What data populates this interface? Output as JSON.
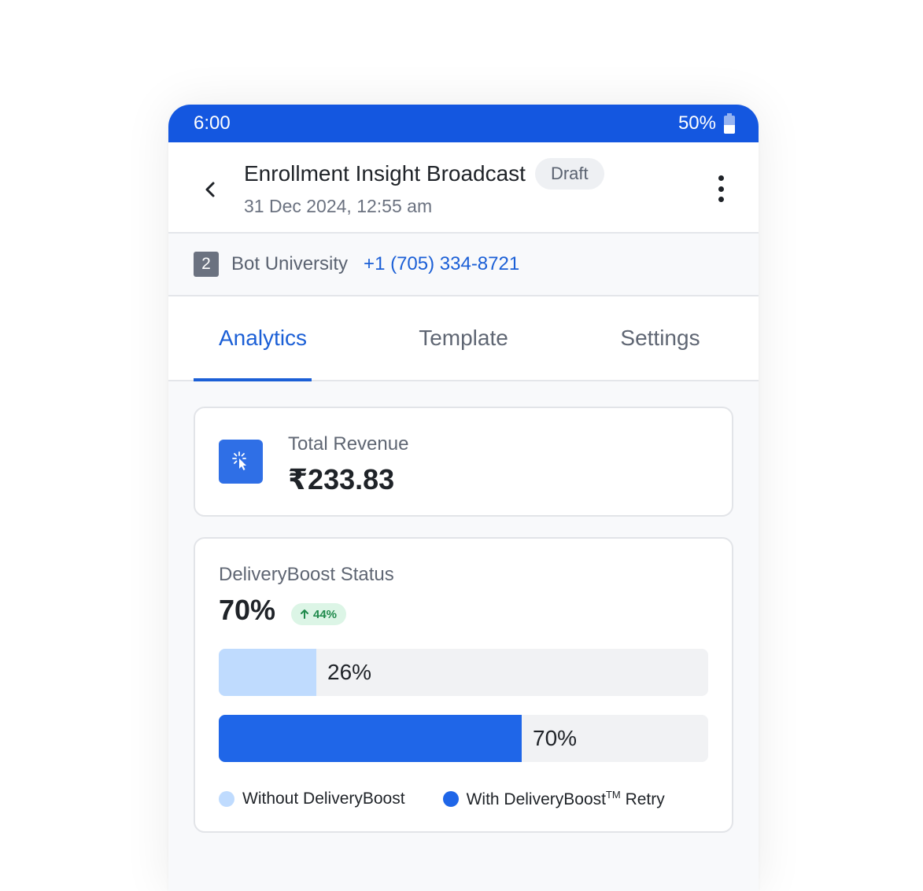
{
  "statusbar": {
    "time": "6:00",
    "battery": "50%",
    "battery_level": 0.5
  },
  "header": {
    "title": "Enrollment Insight Broadcast",
    "badge": "Draft",
    "date": "31 Dec 2024, 12:55 am"
  },
  "sender": {
    "count": "2",
    "name": "Bot University",
    "phone": "+1 (705) 334-8721"
  },
  "tabs": [
    {
      "label": "Analytics",
      "active": true
    },
    {
      "label": "Template",
      "active": false
    },
    {
      "label": "Settings",
      "active": false
    }
  ],
  "revenue": {
    "label": "Total Revenue",
    "value": "₹233.83",
    "icon": "click-cursor-icon"
  },
  "delivery_boost": {
    "label": "DeliveryBoost Status",
    "value": "70%",
    "trend": "44%",
    "trend_direction": "up",
    "bars": [
      {
        "name": "Without DeliveryBoost",
        "value": 26,
        "text": "26%",
        "color": "#bfdbfe"
      },
      {
        "name": "With DeliveryBoost",
        "value": 70,
        "text": "70%",
        "color": "#1f66e8"
      }
    ],
    "legend": {
      "without": "Without DeliveryBoost",
      "with_main": "With DeliveryBoost",
      "with_tm": "TM",
      "with_suffix": " Retry"
    }
  },
  "colors": {
    "primary": "#1457e0",
    "accent": "#1b5fd6",
    "success": "#1f8a4c"
  }
}
